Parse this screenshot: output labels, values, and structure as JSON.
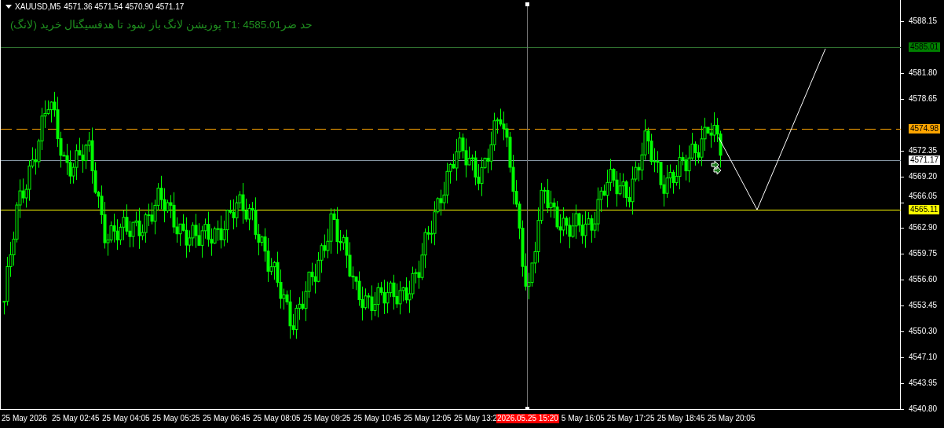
{
  "header": {
    "symbol": "XAUUSD,M5",
    "ohlc": "4571.36 4571.54 4570.90 4571.17"
  },
  "signal_text": "حد ضرT1: 4585.01 پوزیشن لانگ باز شود تا هدفسیگنال خرید (لانگ)",
  "price_axis": {
    "ticks": [
      "4588.15",
      "4581.80",
      "4578.65",
      "4572.35",
      "4569.20",
      "4566.05",
      "4562.90",
      "4559.75",
      "4556.60",
      "4553.45",
      "4550.30",
      "4547.10",
      "4543.95",
      "4540.80"
    ]
  },
  "levels": [
    {
      "label": "4585.01",
      "color": "#008000",
      "kind": "target"
    },
    {
      "label": "4574.98",
      "color": "#ffa500",
      "kind": "entry"
    },
    {
      "label": "4571.17",
      "color": "#ffffff",
      "kind": "bid"
    },
    {
      "label": "4565.11",
      "color": "#ffff00",
      "kind": "stop"
    }
  ],
  "time_axis": {
    "labels_before": [
      "25 May 2026",
      "25 May 02:45",
      "25 May 04:05",
      "25 May 05:25",
      "25 May 06:45",
      "25 May 08:05",
      "25 May 09:25",
      "25 May 10:45",
      "25 May 12:05",
      "25 May 13:2"
    ],
    "cursor_label": "2026.05.25 15:20",
    "labels_after": [
      "5 May 16:05",
      "25 May 17:25",
      "25 May 18:45",
      "25 May 20:05"
    ]
  }
}
